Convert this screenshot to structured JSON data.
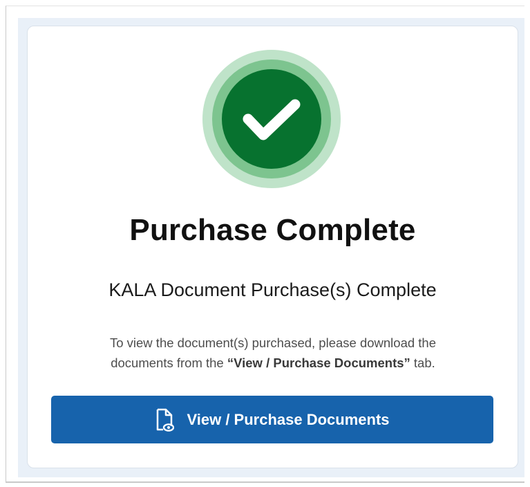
{
  "page": {
    "title": "Purchase Complete",
    "subtitle": "KALA Document Purchase(s) Complete",
    "message": {
      "line1": "To view the document(s) purchased, please download the",
      "line2_prefix": "documents from the ",
      "line2_emphasis": "“View / Purchase Documents”",
      "line2_suffix": " tab."
    }
  },
  "button": {
    "label": "View / Purchase Documents",
    "icon": "document-view-icon"
  },
  "icon": {
    "name": "checkmark-icon"
  },
  "colors": {
    "primary_button": "#1763ac",
    "success_dark": "#07722f",
    "success_mid": "#7dc48f",
    "success_light": "#bfe3c9"
  }
}
